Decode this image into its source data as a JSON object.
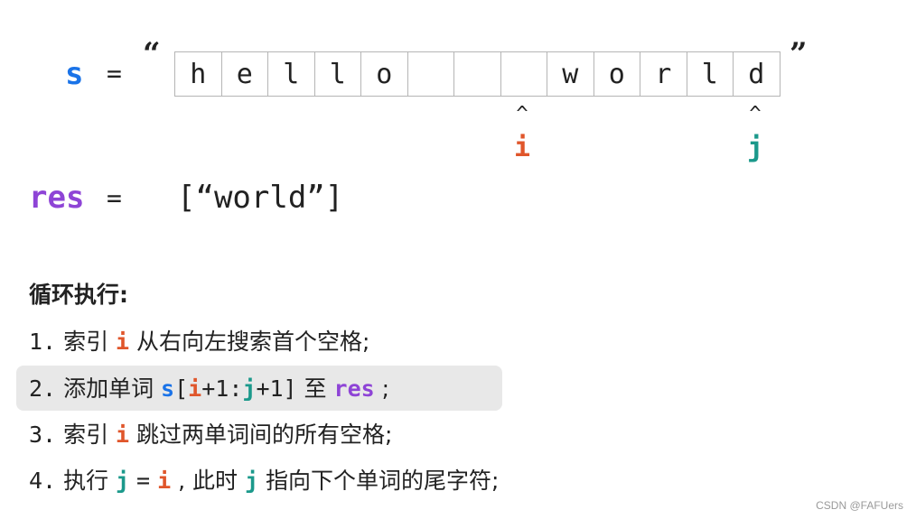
{
  "header": {
    "s_label": "s",
    "equals": "=",
    "open_quote": "“",
    "close_quote": "”"
  },
  "char_array": [
    "h",
    "e",
    "l",
    "l",
    "o",
    "",
    "",
    "",
    "w",
    "o",
    "r",
    "l",
    "d"
  ],
  "pointers": {
    "caret": "^",
    "i_label": "i",
    "j_label": "j"
  },
  "result": {
    "label": "res",
    "equals": "=",
    "value": "[“world”]"
  },
  "loop": {
    "title": "循环执行:",
    "steps": [
      {
        "num": "1.",
        "text_a": "索引",
        "var": "i",
        "text_b": "从右向左搜索首个空格;"
      },
      {
        "num": "2.",
        "text_a": "添加单词",
        "code_s": "s",
        "code_bracket_open": "[",
        "code_i": "i",
        "code_mid": "+1:",
        "code_j": "j",
        "code_end": "+1]",
        "text_to": "至",
        "code_res": "res",
        "text_semi": ";"
      },
      {
        "num": "3.",
        "text_a": "索引",
        "var": "i",
        "text_b": "跳过两单词间的所有空格;"
      },
      {
        "num": "4.",
        "text_a": "执行",
        "var_j": "j",
        "equals": "=",
        "var_i": "i",
        "comma": ",",
        "text_b": "此时",
        "var_j2": "j",
        "text_c": "指向下个单词的尾字符;"
      }
    ]
  },
  "watermark": "CSDN @FAFUers",
  "colors": {
    "s": "#1a73e8",
    "i": "#e0562b",
    "j": "#1b998b",
    "res": "#8e44d6",
    "highlight": "#e8e8e8"
  }
}
